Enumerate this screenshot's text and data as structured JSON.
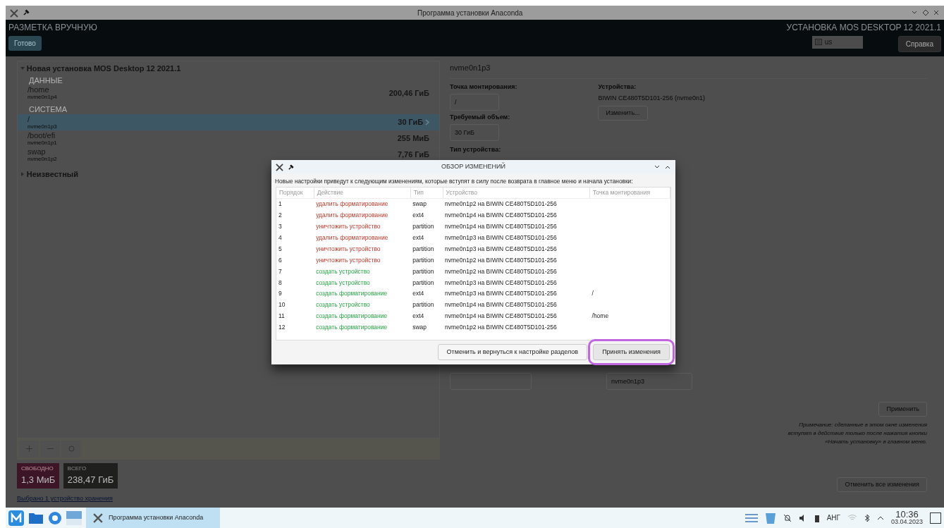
{
  "window": {
    "title": "Программа установки Anaconda"
  },
  "header": {
    "title": "РАЗМЕТКА ВРУЧНУЮ",
    "done_button": "Готово",
    "product": "УСТАНОВКА MOS DESKTOP 12 2021.1",
    "keyboard": "us",
    "help_button": "Справка"
  },
  "partitions": {
    "root": {
      "label": "Новая установка MOS Desktop 12 2021.1",
      "expanded": true,
      "groups": [
        {
          "name": "ДАННЫЕ",
          "items": [
            {
              "mount": "/home",
              "device": "nvme0n1p4",
              "size": "200,46 ГиБ",
              "selected": false
            }
          ]
        },
        {
          "name": "СИСТЕМА",
          "items": [
            {
              "mount": "/",
              "device": "nvme0n1p3",
              "size": "30 ГиБ",
              "selected": true
            },
            {
              "mount": "/boot/efi",
              "device": "nvme0n1p1",
              "size": "255 МиБ",
              "selected": false
            },
            {
              "mount": "swap",
              "device": "nvme0n1p2",
              "size": "7,76 ГиБ",
              "selected": false
            }
          ]
        }
      ]
    },
    "other": {
      "label": "Неизвестный",
      "expanded": false
    },
    "free": {
      "label": "СВОБОДНО",
      "value": "1,3 МиБ"
    },
    "total": {
      "label": "ВСЕГО",
      "value": "238,47 ГиБ"
    },
    "storage_link": "Выбрано 1 устройство хранения"
  },
  "details": {
    "title": "nvme0n1p3",
    "mount_label": "Точка монтирования:",
    "mount_value": "/",
    "size_label": "Требуемый объем:",
    "size_value": "30 ГиБ",
    "devices_label": "Устройства:",
    "devices_value": "BIWIN CE480T5D101-256 (nvme0n1)",
    "change_button": "Изменить...",
    "type_label": "Тип устройства:",
    "name_value": "nvme0n1p3",
    "apply_button": "Применить",
    "note": "Примечание: сделанные в этом окне изменения вступят в действие только после нажатия кнопки «Начать установку» в главном меню.",
    "reset_button": "Отменить все изменения"
  },
  "dialog": {
    "title": "ОБЗОР ИЗМЕНЕНИЙ",
    "description": "Новые настройки приведут к следующим изменениям, которые вступят в силу после возврата в главное меню и начала установки:",
    "columns": [
      "Порядок",
      "Действие",
      "Тип",
      "Устройство",
      "Точка монтирования"
    ],
    "rows": [
      {
        "order": "1",
        "action": "удалить форматирование",
        "kind": "destroy",
        "type": "swap",
        "device": "nvme0n1p2 на BIWIN CE480T5D101-256",
        "mount": ""
      },
      {
        "order": "2",
        "action": "удалить форматирование",
        "kind": "destroy",
        "type": "ext4",
        "device": "nvme0n1p4 на BIWIN CE480T5D101-256",
        "mount": ""
      },
      {
        "order": "3",
        "action": "уничтожить устройство",
        "kind": "destroy",
        "type": "partition",
        "device": "nvme0n1p4 на BIWIN CE480T5D101-256",
        "mount": ""
      },
      {
        "order": "4",
        "action": "удалить форматирование",
        "kind": "destroy",
        "type": "ext4",
        "device": "nvme0n1p3 на BIWIN CE480T5D101-256",
        "mount": ""
      },
      {
        "order": "5",
        "action": "уничтожить устройство",
        "kind": "destroy",
        "type": "partition",
        "device": "nvme0n1p3 на BIWIN CE480T5D101-256",
        "mount": ""
      },
      {
        "order": "6",
        "action": "уничтожить устройство",
        "kind": "destroy",
        "type": "partition",
        "device": "nvme0n1p2 на BIWIN CE480T5D101-256",
        "mount": ""
      },
      {
        "order": "7",
        "action": "создать устройство",
        "kind": "create",
        "type": "partition",
        "device": "nvme0n1p2 на BIWIN CE480T5D101-256",
        "mount": ""
      },
      {
        "order": "8",
        "action": "создать устройство",
        "kind": "create",
        "type": "partition",
        "device": "nvme0n1p3 на BIWIN CE480T5D101-256",
        "mount": ""
      },
      {
        "order": "9",
        "action": "создать форматирование",
        "kind": "create",
        "type": "ext4",
        "device": "nvme0n1p3 на BIWIN CE480T5D101-256",
        "mount": "/"
      },
      {
        "order": "10",
        "action": "создать устройство",
        "kind": "create",
        "type": "partition",
        "device": "nvme0n1p4 на BIWIN CE480T5D101-256",
        "mount": ""
      },
      {
        "order": "11",
        "action": "создать форматирование",
        "kind": "create",
        "type": "ext4",
        "device": "nvme0n1p4 на BIWIN CE480T5D101-256",
        "mount": "/home"
      },
      {
        "order": "12",
        "action": "создать форматирование",
        "kind": "create",
        "type": "swap",
        "device": "nvme0n1p2 на BIWIN CE480T5D101-256",
        "mount": ""
      }
    ],
    "cancel_button": "Отменить и вернуться к настройке разделов",
    "accept_button": "Принять изменения",
    "accept_highlighted": true
  },
  "taskbar": {
    "task": "Программа установки Anaconda",
    "language": "АНГ",
    "time": "10:36",
    "date": "03.04.2023"
  }
}
